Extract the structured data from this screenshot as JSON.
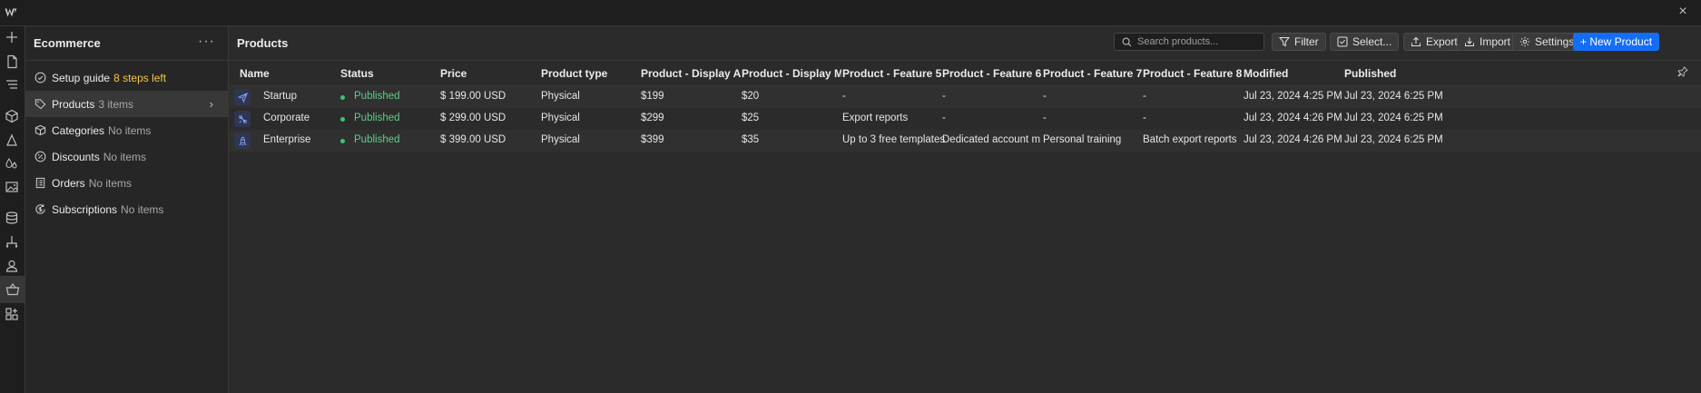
{
  "window": {
    "close_label": "×"
  },
  "sidebar": {
    "title": "Ecommerce",
    "more": "···",
    "items": [
      {
        "label": "Setup guide",
        "meta": "8 steps left",
        "icon": "check-circle-icon"
      },
      {
        "label": "Products",
        "meta": "3 items",
        "icon": "tag-icon",
        "active": true
      },
      {
        "label": "Categories",
        "meta": "No items",
        "icon": "category-icon"
      },
      {
        "label": "Discounts",
        "meta": "No items",
        "icon": "discount-icon"
      },
      {
        "label": "Orders",
        "meta": "No items",
        "icon": "orders-icon"
      },
      {
        "label": "Subscriptions",
        "meta": "No items",
        "icon": "subscriptions-icon"
      }
    ]
  },
  "main": {
    "title": "Products",
    "search": {
      "placeholder": "Search products..."
    },
    "toolbar": {
      "filter": "Filter",
      "select": "Select...",
      "export": "Export",
      "import": "Import",
      "settings": "Settings",
      "new_product": "+ New Product"
    },
    "columns": [
      "Name",
      "Status",
      "Price",
      "Product type",
      "Product - Display Annualy",
      "Product - Display Monthly",
      "Product - Feature 5",
      "Product - Feature 6",
      "Product - Feature 7",
      "Product - Feature 8",
      "Modified",
      "Published"
    ],
    "rows": [
      {
        "name": "Startup",
        "icon": "paper-plane-icon",
        "status": "Published",
        "price": "$ 199.00 USD",
        "type": "Physical",
        "annual": "$199",
        "monthly": "$20",
        "f5": "-",
        "f6": "-",
        "f7": "-",
        "f8": "-",
        "modified": "Jul 23, 2024 4:25 PM",
        "published": "Jul 23, 2024 6:25 PM"
      },
      {
        "name": "Corporate",
        "icon": "airplane-icon",
        "status": "Published",
        "price": "$ 299.00 USD",
        "type": "Physical",
        "annual": "$299",
        "monthly": "$25",
        "f5": "Export reports",
        "f6": "-",
        "f7": "-",
        "f8": "-",
        "modified": "Jul 23, 2024 4:26 PM",
        "published": "Jul 23, 2024 6:25 PM"
      },
      {
        "name": "Enterprise",
        "icon": "rocket-icon",
        "status": "Published",
        "price": "$ 399.00 USD",
        "type": "Physical",
        "annual": "$399",
        "monthly": "$35",
        "f5": "Up to 3 free templates",
        "f6": "Dedicated account mana...",
        "f7": "Personal training",
        "f8": "Batch export reports",
        "modified": "Jul 23, 2024 4:26 PM",
        "published": "Jul 23, 2024 6:25 PM"
      }
    ]
  },
  "colors": {
    "accent": "#146ef5",
    "published": "#5fce8a",
    "warning": "#f5c542"
  }
}
